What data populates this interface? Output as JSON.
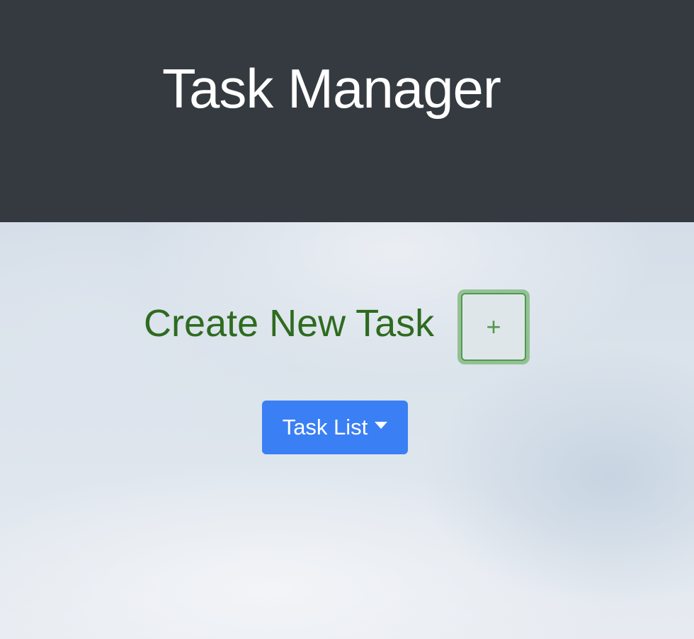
{
  "header": {
    "title": "Task Manager",
    "background_color": "#343a40"
  },
  "main": {
    "create_heading": "Create New Task",
    "add_button": {
      "label": "+",
      "icon": "plus-icon",
      "accent_color": "#4f9a4c"
    },
    "task_list_button": {
      "label": "Task List",
      "icon": "caret-down-icon",
      "background_color": "#3b7ff5"
    }
  }
}
